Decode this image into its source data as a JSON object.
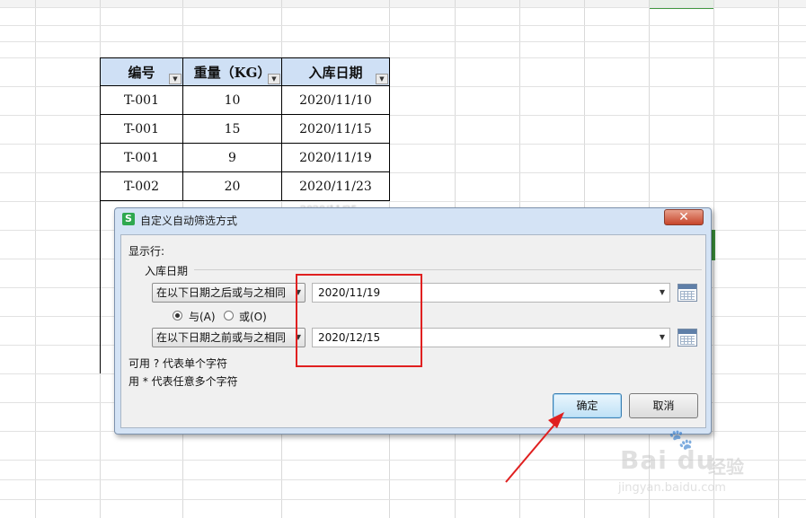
{
  "table": {
    "headers": [
      "编号",
      "重量（KG）",
      "入库日期"
    ],
    "rows": [
      [
        "T-001",
        "10",
        "2020/11/10"
      ],
      [
        "T-001",
        "15",
        "2020/11/15"
      ],
      [
        "T-001",
        "9",
        "2020/11/19"
      ],
      [
        "T-002",
        "20",
        "2020/11/23"
      ]
    ],
    "obscured_row_text": "2020/11/25"
  },
  "dialog": {
    "title": "自定义自动筛选方式",
    "app_icon_letter": "S",
    "close_symbol": "✕",
    "show_rows_label": "显示行:",
    "field_name": "入库日期",
    "condition1": {
      "operator": "在以下日期之后或与之相同",
      "value": "2020/11/19"
    },
    "logic": {
      "and_label": "与(A)",
      "or_label": "或(O)",
      "selected": "and"
    },
    "condition2": {
      "operator": "在以下日期之前或与之相同",
      "value": "2020/12/15"
    },
    "hint1": "可用 ? 代表单个字符",
    "hint2": "用 * 代表任意多个字符",
    "ok_label": "确定",
    "cancel_label": "取消"
  },
  "watermark": {
    "logo": "Bai du",
    "cn": "经验",
    "url": "jingyan.baidu.com"
  },
  "colors": {
    "header_fill": "#cfe0f5",
    "annotation_red": "#e02020",
    "dialog_frame": "#d4e3f5",
    "selection_green": "#3a8f3a"
  },
  "icons": {
    "filter_dropdown": "chevron-down-icon",
    "calendar": "calendar-icon",
    "close": "close-icon",
    "app": "wps-spreadsheet-icon"
  }
}
